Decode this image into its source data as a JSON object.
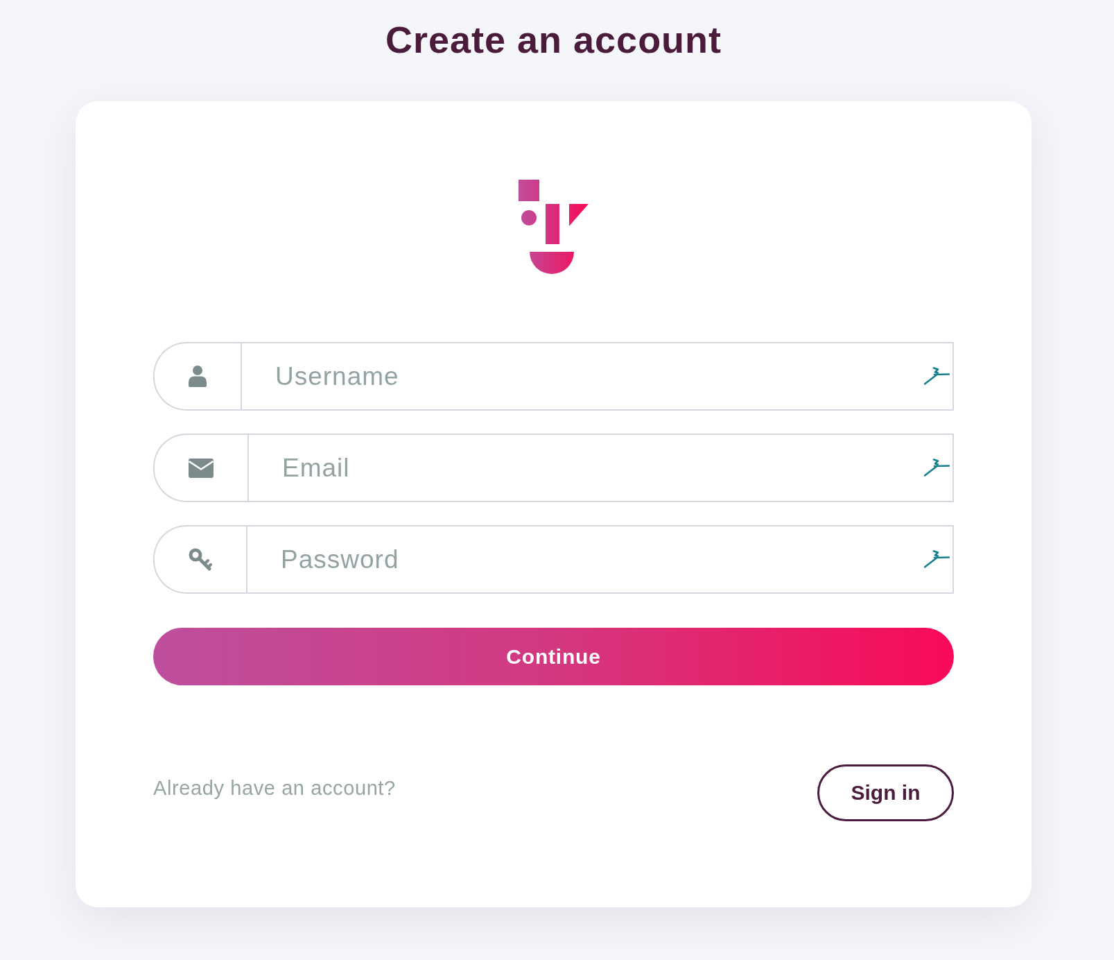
{
  "title": "Create an account",
  "fields": [
    {
      "kind": "username",
      "placeholder": "Username"
    },
    {
      "kind": "email",
      "placeholder": "Email"
    },
    {
      "kind": "password",
      "placeholder": "Password"
    }
  ],
  "submit_button": "Continue",
  "footer": {
    "prompt": "Already have an account?",
    "button": "Sign in"
  }
}
